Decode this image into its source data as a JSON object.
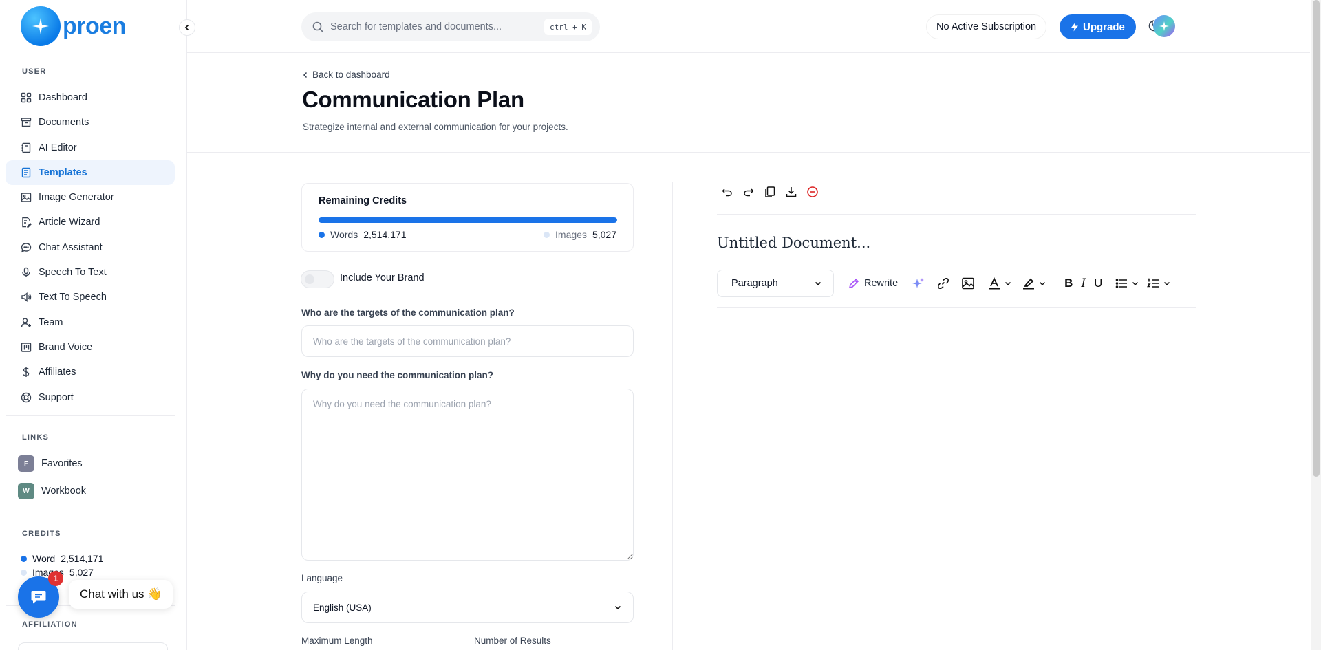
{
  "app": {
    "logo_text": "proen"
  },
  "sidebar": {
    "section_user": "USER",
    "items": [
      {
        "label": "Dashboard",
        "icon": "grid-icon"
      },
      {
        "label": "Documents",
        "icon": "archive-icon"
      },
      {
        "label": "AI Editor",
        "icon": "notebook-icon"
      },
      {
        "label": "Templates",
        "icon": "file-text-icon",
        "active": true
      },
      {
        "label": "Image Generator",
        "icon": "image-icon"
      },
      {
        "label": "Article Wizard",
        "icon": "file-edit-icon"
      },
      {
        "label": "Chat Assistant",
        "icon": "chat-icon"
      },
      {
        "label": "Speech To Text",
        "icon": "mic-icon"
      },
      {
        "label": "Text To Speech",
        "icon": "speaker-icon"
      },
      {
        "label": "Team",
        "icon": "user-plus-icon"
      },
      {
        "label": "Brand Voice",
        "icon": "columns-icon"
      },
      {
        "label": "Affiliates",
        "icon": "dollar-icon"
      },
      {
        "label": "Support",
        "icon": "lifebuoy-icon"
      }
    ],
    "section_links": "LINKS",
    "links": [
      {
        "badge": "F",
        "label": "Favorites",
        "color": "#7c7f96"
      },
      {
        "badge": "W",
        "label": "Workbook",
        "color": "#5f8a83"
      }
    ],
    "section_credits": "CREDITS",
    "credits": {
      "word_label": "Word",
      "word_value": "2,514,171",
      "image_label": "Images",
      "image_value": "5,027"
    },
    "section_affiliation": "AFFILIATION"
  },
  "chat": {
    "badge_count": "1",
    "label": "Chat with us 👋"
  },
  "header": {
    "search_placeholder": "Search for templates and documents...",
    "shortcut": "ctrl + K",
    "subscription": "No Active Subscription",
    "upgrade": "Upgrade"
  },
  "page": {
    "back": "Back to dashboard",
    "title": "Communication Plan",
    "subtitle": "Strategize internal and external communication for your projects."
  },
  "credits_card": {
    "title": "Remaining Credits",
    "words_label": "Words",
    "words_value": "2,514,171",
    "images_label": "Images",
    "images_value": "5,027",
    "words_fraction": 1.0
  },
  "form": {
    "brand_toggle": "Include Your Brand",
    "targets_label": "Who are the targets of the communication plan?",
    "targets_placeholder": "Who are the targets of the communication plan?",
    "why_label": "Why do you need the communication plan?",
    "why_placeholder": "Why do you need the communication plan?",
    "language_label": "Language",
    "language_value": "English (USA)",
    "max_length_label": "Maximum Length",
    "num_results_label": "Number of Results"
  },
  "editor": {
    "doc_title": "Untitled Document...",
    "paragraph": "Paragraph",
    "rewrite": "Rewrite",
    "bold": "B",
    "italic": "I",
    "underline": "U"
  },
  "colors": {
    "accent": "#1a73e8",
    "active_bg": "#eef4fd"
  }
}
